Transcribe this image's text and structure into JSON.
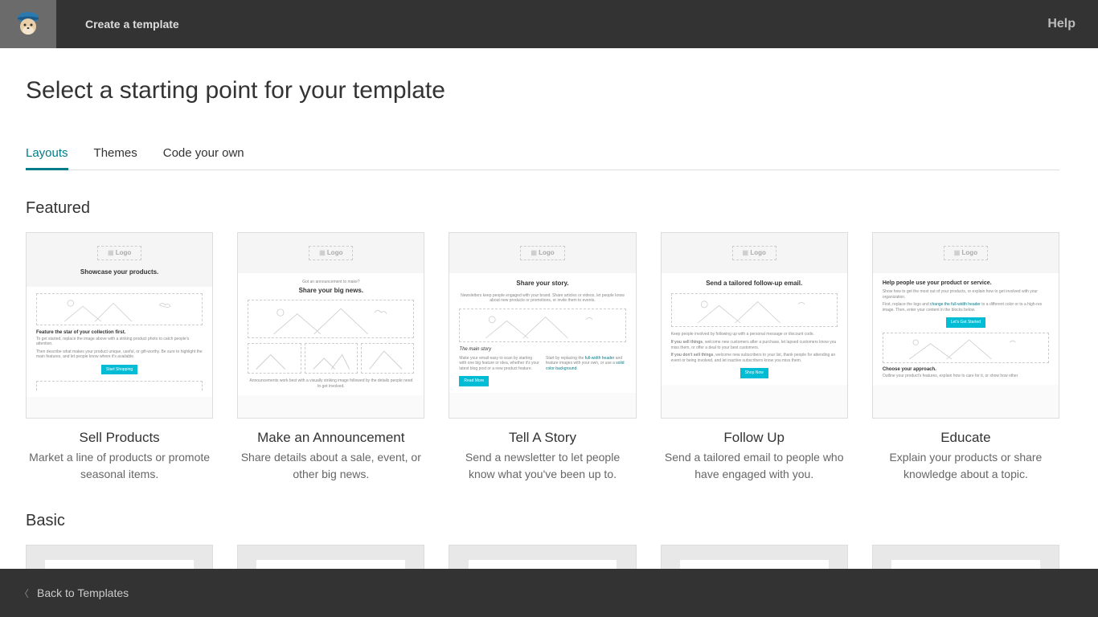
{
  "topbar": {
    "title": "Create a template",
    "help": "Help"
  },
  "page_title": "Select a starting point for your template",
  "tabs": [
    {
      "label": "Layouts",
      "active": true
    },
    {
      "label": "Themes",
      "active": false
    },
    {
      "label": "Code your own",
      "active": false
    }
  ],
  "sections": {
    "featured": {
      "title": "Featured",
      "cards": [
        {
          "title": "Sell Products",
          "desc": "Market a line of products or promote seasonal items.",
          "preview": {
            "headline": "Showcase your products.",
            "sub_bold": "Feature the star of your collection first.",
            "button": "Start Shopping"
          }
        },
        {
          "title": "Make an Announcement",
          "desc": "Share details about a sale, event, or other big news.",
          "preview": {
            "eyebrow": "Got an announcement to make?",
            "headline": "Share your big news."
          }
        },
        {
          "title": "Tell A Story",
          "desc": "Send a newsletter to let people know what you've been up to.",
          "preview": {
            "headline": "Share your story.",
            "sub": "Newsletters keep people engaged with your brand. Share articles or videos, let people know about new products or promotions, or invite them to events.",
            "section": "The main story",
            "button": "Read More"
          }
        },
        {
          "title": "Follow Up",
          "desc": "Send a tailored email to people who have engaged with you.",
          "preview": {
            "headline": "Send a tailored follow-up email.",
            "button": "Shop Now"
          }
        },
        {
          "title": "Educate",
          "desc": "Explain your products or share knowledge about a topic.",
          "preview": {
            "headline": "Help people use your product or service.",
            "link": "change the full-width header",
            "button": "Let's Get Started",
            "section": "Choose your approach."
          }
        }
      ]
    },
    "basic": {
      "title": "Basic",
      "cards": [
        {},
        {},
        {},
        {},
        {}
      ]
    }
  },
  "footer": {
    "back": "Back to Templates"
  },
  "logo_placeholder": "Logo"
}
